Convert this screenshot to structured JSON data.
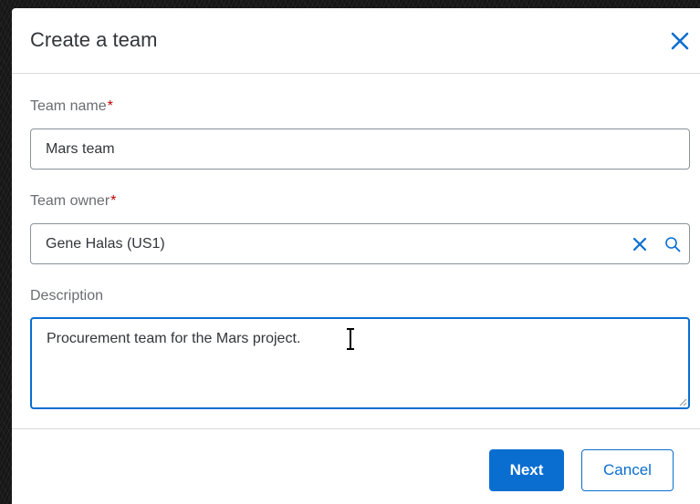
{
  "dialog": {
    "title": "Create a team",
    "close_icon": "close-icon"
  },
  "form": {
    "team_name": {
      "label": "Team name",
      "required_marker": "*",
      "value": "Mars team"
    },
    "team_owner": {
      "label": "Team owner",
      "required_marker": "*",
      "value": "Gene Halas (US1)",
      "clear_icon": "clear-icon",
      "search_icon": "search-icon"
    },
    "description": {
      "label": "Description",
      "value": "Procurement team for the Mars project."
    }
  },
  "footer": {
    "next_label": "Next",
    "cancel_label": "Cancel"
  },
  "colors": {
    "accent": "#0a6ed1",
    "required": "#bb0000",
    "label": "#6a6d70",
    "text": "#32363a"
  }
}
